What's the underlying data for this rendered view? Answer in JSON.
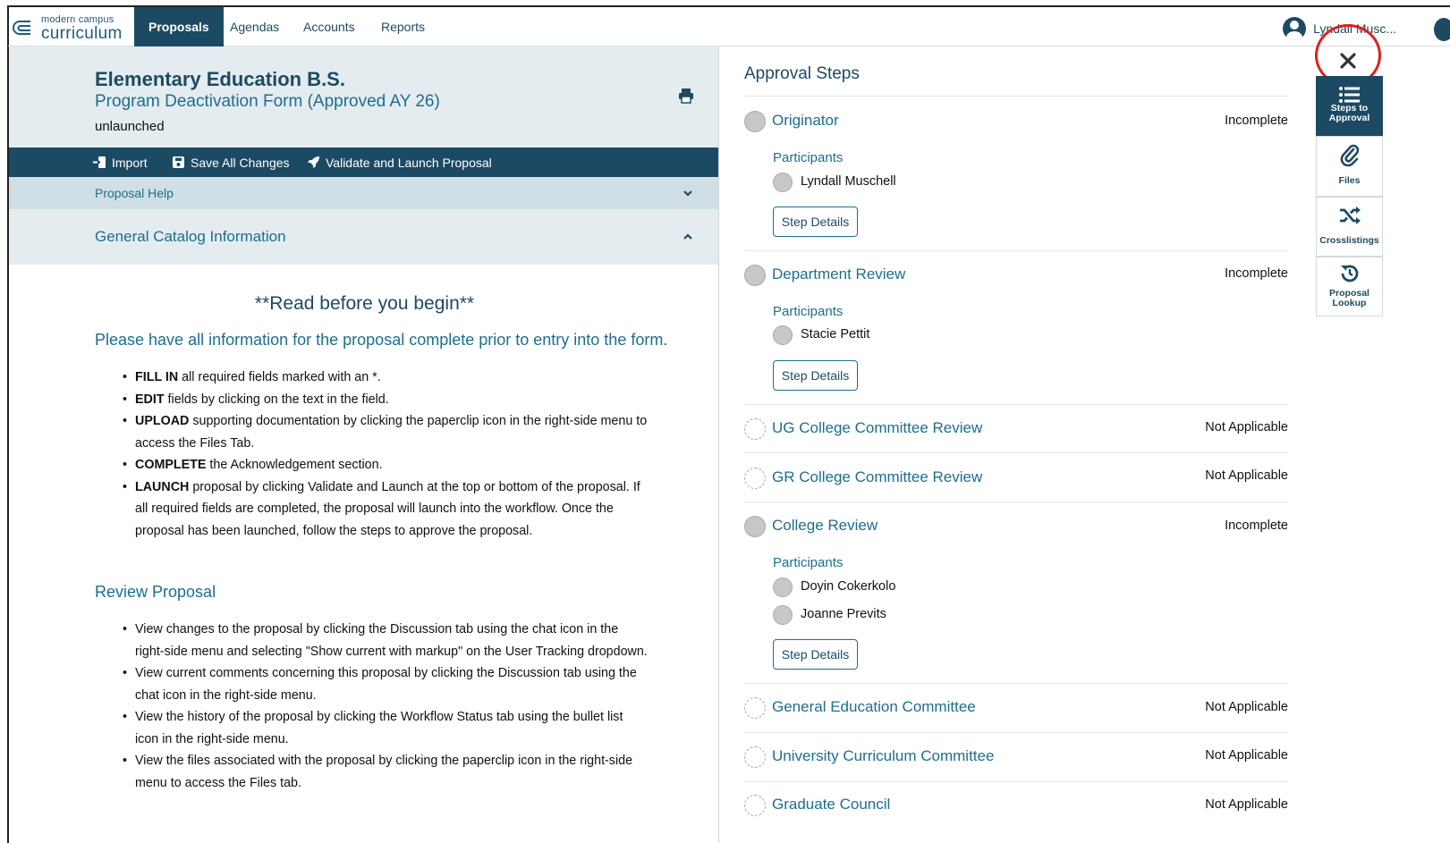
{
  "nav": {
    "logo_small": "modern campus",
    "logo_big": "curriculum",
    "items": [
      {
        "label": "Proposals",
        "active": true
      },
      {
        "label": "Agendas",
        "active": false
      },
      {
        "label": "Accounts",
        "active": false
      },
      {
        "label": "Reports",
        "active": false
      }
    ],
    "user_name": "Lyndall Musc..."
  },
  "proposal": {
    "title": "Elementary Education B.S.",
    "subtitle": "Program Deactivation Form (Approved AY 26)",
    "status": "unlaunched",
    "print_icon": "print-icon"
  },
  "toolbar": {
    "import": "Import",
    "save": "Save All Changes",
    "validate": "Validate and Launch Proposal"
  },
  "sections": {
    "help": "Proposal Help",
    "catalog": "General Catalog Information"
  },
  "content": {
    "read_title": "**Read before you begin**",
    "please": "Please have all information for the proposal complete prior to entry into the form.",
    "instructions": [
      {
        "bold": "FILL IN",
        "text": " all required fields marked with an *."
      },
      {
        "bold": "EDIT",
        "text": " fields by clicking on the text in the field."
      },
      {
        "bold": "UPLOAD",
        "text": " supporting documentation by clicking the paperclip icon in the right-side menu to access the Files Tab."
      },
      {
        "bold": "COMPLETE",
        "text": " the Acknowledgement section."
      },
      {
        "bold": "LAUNCH",
        "text": " proposal by clicking Validate and Launch at the top or bottom of the proposal.  If all required fields are completed, the proposal will launch into the workflow. Once the proposal has been launched, follow the steps to approve the proposal."
      }
    ],
    "review_title": "Review Proposal",
    "review_items": [
      "View changes to the proposal by clicking the Discussion tab using the chat icon in the right-side menu and selecting \"Show current with markup\" on the User Tracking dropdown.",
      "View current comments concerning this proposal by clicking the Discussion tab using the chat icon in the right-side menu.",
      "View the history of the proposal by clicking the Workflow Status tab using the bullet list icon in the right-side menu.",
      "View the files associated with the proposal by clicking the paperclip icon in the right-side menu to access the Files tab."
    ]
  },
  "approval": {
    "title": "Approval Steps",
    "participants_label": "Participants",
    "step_details_label": "Step Details",
    "steps": [
      {
        "name": "Originator",
        "status": "Incomplete",
        "participants": [
          "Lyndall Muschell"
        ]
      },
      {
        "name": "Department Review",
        "status": "Incomplete",
        "participants": [
          "Stacie Pettit"
        ]
      },
      {
        "name": "UG College Committee Review",
        "status": "Not Applicable",
        "participants": []
      },
      {
        "name": "GR College Committee Review",
        "status": "Not Applicable",
        "participants": []
      },
      {
        "name": "College Review",
        "status": "Incomplete",
        "participants": [
          "Doyin Cokerkolo",
          "Joanne Previts"
        ]
      },
      {
        "name": "General Education Committee",
        "status": "Not Applicable",
        "participants": []
      },
      {
        "name": "University Curriculum Committee",
        "status": "Not Applicable",
        "participants": []
      },
      {
        "name": "Graduate Council",
        "status": "Not Applicable",
        "participants": []
      }
    ]
  },
  "sidemenu": {
    "close_icon": "close-icon",
    "items": [
      {
        "label_line1": "Steps to",
        "label_line2": "Approval",
        "icon": "list-icon",
        "active": true
      },
      {
        "label_line1": "Files",
        "label_line2": "",
        "icon": "paperclip-icon",
        "active": false
      },
      {
        "label_line1": "Crosslistings",
        "label_line2": "",
        "icon": "shuffle-icon",
        "active": false
      },
      {
        "label_line1": "Proposal",
        "label_line2": "Lookup",
        "icon": "history-icon",
        "active": false
      }
    ]
  },
  "colors": {
    "brand_dark": "#1d4a63",
    "brand_link": "#1d6e8f",
    "header_bg": "#e4ecef",
    "highlight_ring": "#e02020"
  }
}
